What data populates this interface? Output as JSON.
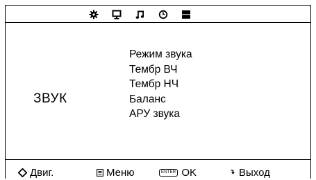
{
  "topbar": {
    "tabs": [
      {
        "icon": "gear-icon"
      },
      {
        "icon": "monitor-icon"
      },
      {
        "icon": "music-note-icon"
      },
      {
        "icon": "clock-icon"
      },
      {
        "icon": "block-icon"
      }
    ]
  },
  "section": {
    "title": "ЗВУК"
  },
  "menu": {
    "items": [
      {
        "label": "Режим звука"
      },
      {
        "label": "Тембр ВЧ"
      },
      {
        "label": "Тембр НЧ"
      },
      {
        "label": "Баланс"
      },
      {
        "label": "АРУ звука"
      }
    ]
  },
  "footer": {
    "nav_label": "Двиг.",
    "menu_label": "Меню",
    "enter_key": "ENTER",
    "ok_label": "OK",
    "exit_label": "Выход"
  }
}
